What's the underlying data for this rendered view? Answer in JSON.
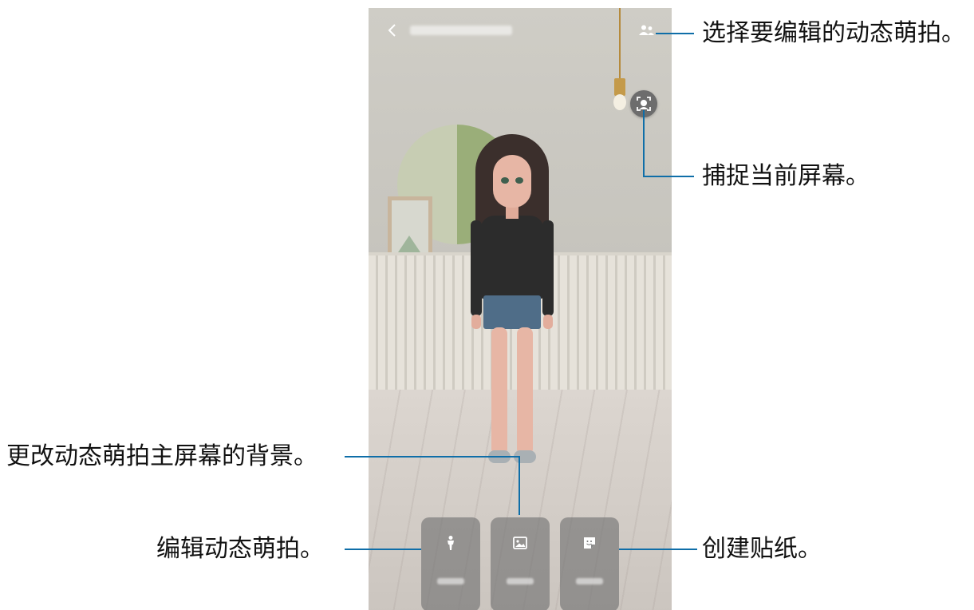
{
  "phone": {
    "back_icon": "chevron-left-icon",
    "people_icon": "people-icon",
    "capture_icon": "face-capture-icon"
  },
  "toolbar": {
    "items": [
      {
        "icon": "person-icon"
      },
      {
        "icon": "image-icon"
      },
      {
        "icon": "sticker-icon"
      }
    ]
  },
  "callouts": {
    "select": "选择要编辑的动态萌拍。",
    "capture": "捕捉当前屏幕。",
    "background": "更改动态萌拍主屏幕的背景。",
    "edit": "编辑动态萌拍。",
    "sticker": "创建贴纸。"
  },
  "colors": {
    "callout_line": "#0f6ea8",
    "toolbar_bg": "#787878"
  }
}
